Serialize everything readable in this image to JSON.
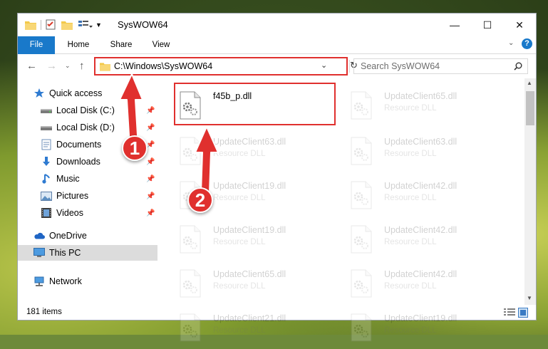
{
  "window": {
    "title": "SysWOW64",
    "minimize_glyph": "—",
    "maximize_glyph": "☐",
    "close_glyph": "✕"
  },
  "ribbon": {
    "tabs": [
      {
        "label": "File"
      },
      {
        "label": "Home"
      },
      {
        "label": "Share"
      },
      {
        "label": "View"
      }
    ],
    "help_glyph": "?"
  },
  "navigation": {
    "address": "C:\\Windows\\SysWOW64",
    "search_placeholder": "Search SysWOW64"
  },
  "sidebar": {
    "items": [
      {
        "label": "Quick access",
        "icon": "star-icon"
      },
      {
        "label": "Local Disk (C:)",
        "icon": "drive-icon",
        "pinned": true
      },
      {
        "label": "Local Disk (D:)",
        "icon": "drive-icon",
        "pinned": true
      },
      {
        "label": "Documents",
        "icon": "documents-icon",
        "pinned": true
      },
      {
        "label": "Downloads",
        "icon": "download-icon",
        "pinned": true
      },
      {
        "label": "Music",
        "icon": "music-icon",
        "pinned": true
      },
      {
        "label": "Pictures",
        "icon": "pictures-icon",
        "pinned": true
      },
      {
        "label": "Videos",
        "icon": "videos-icon",
        "pinned": true
      },
      {
        "label": "OneDrive",
        "icon": "cloud-icon"
      },
      {
        "label": "This PC",
        "icon": "computer-icon",
        "selected": true
      },
      {
        "label": "Network",
        "icon": "network-icon"
      }
    ]
  },
  "files": [
    {
      "name": "f45b_p.dll",
      "type": ""
    },
    {
      "name": "UpdateClient65.dll",
      "type": "Resource DLL"
    },
    {
      "name": "UpdateClient63.dll",
      "type": "Resource DLL"
    },
    {
      "name": "UpdateClient63.dll",
      "type": "Resource DLL"
    },
    {
      "name": "UpdateClient19.dll",
      "type": "Resource DLL"
    },
    {
      "name": "UpdateClient42.dll",
      "type": "Resource DLL"
    },
    {
      "name": "UpdateClient19.dll",
      "type": "Resource DLL"
    },
    {
      "name": "UpdateClient42.dll",
      "type": "Resource DLL"
    },
    {
      "name": "UpdateClient65.dll",
      "type": "Resource DLL"
    },
    {
      "name": "UpdateClient42.dll",
      "type": "Resource DLL"
    },
    {
      "name": "UpdateClient21.dll",
      "type": "Resource DLL"
    },
    {
      "name": "UpdateClient19.dll",
      "type": "Resource DLL"
    }
  ],
  "status": {
    "item_count": "181 items"
  },
  "annotations": {
    "step1": "1",
    "step2": "2"
  },
  "colors": {
    "accent": "#1979ca",
    "highlight": "#e0302e"
  }
}
